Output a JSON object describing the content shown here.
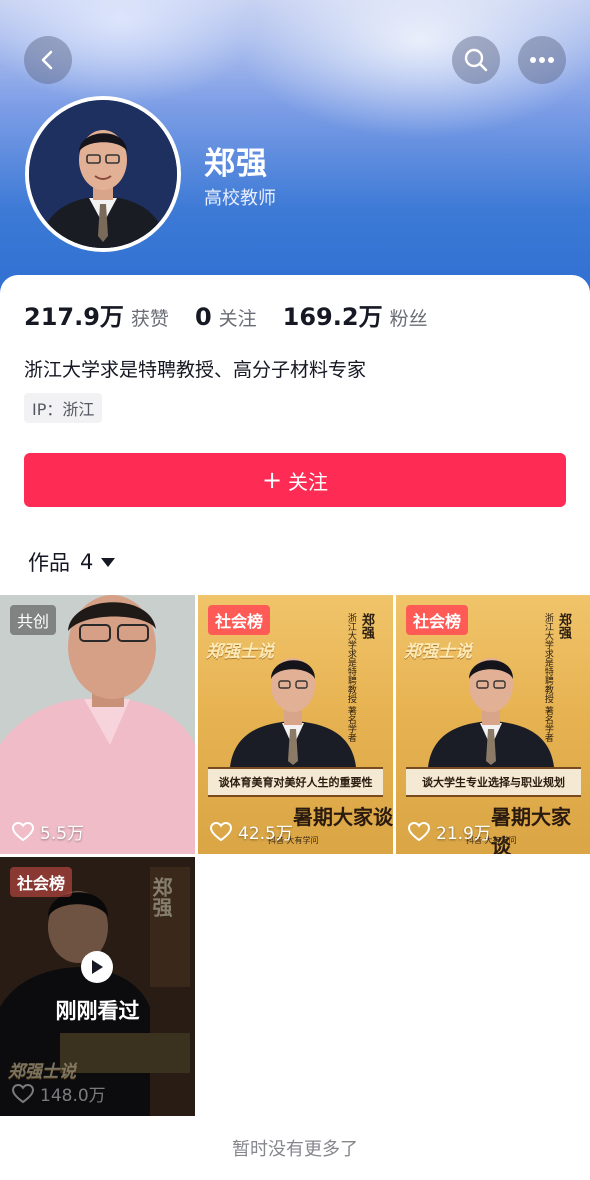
{
  "header": {
    "buttons": {
      "back_icon": "chevron-left-icon",
      "search_icon": "search-icon",
      "more_icon": "more-dots-icon"
    }
  },
  "profile": {
    "name": "郑强",
    "title": "高校教师",
    "stats": [
      {
        "value": "217.9万",
        "label": "获赞"
      },
      {
        "value": "0",
        "label": "关注"
      },
      {
        "value": "169.2万",
        "label": "粉丝"
      }
    ],
    "bio": "浙江大学求是特聘教授、高分子材料专家",
    "ip": "IP：浙江",
    "follow_label": "关注",
    "follow_color": "#fe2c55"
  },
  "works": {
    "tab_label": "作品",
    "count": "4",
    "items": [
      {
        "tag": "共创",
        "likes": "5.5万"
      },
      {
        "tag": "社会榜",
        "likes": "42.5万",
        "vertical_big": "郑强",
        "vertical_small": "浙江大学求是特聘教授 著名学者",
        "banner": "谈体育美育对美好人生的重要性",
        "poster_title": "暑期大家谈",
        "poster_foot": "抖音  大有学问",
        "brand": "郑强士说"
      },
      {
        "tag": "社会榜",
        "likes": "21.9万",
        "vertical_big": "郑强",
        "vertical_small": "浙江大学求是特聘教授 著名学者",
        "banner": "谈大学生专业选择与职业规划",
        "poster_title": "暑期大家谈",
        "poster_foot": "抖音  大有学问",
        "brand": "郑强士说"
      },
      {
        "tag": "社会榜",
        "likes": "148.0万",
        "vertical_big": "郑强",
        "watched_label": "刚刚看过",
        "brand": "郑强士说"
      }
    ],
    "end_note": "暂时没有更多了"
  }
}
